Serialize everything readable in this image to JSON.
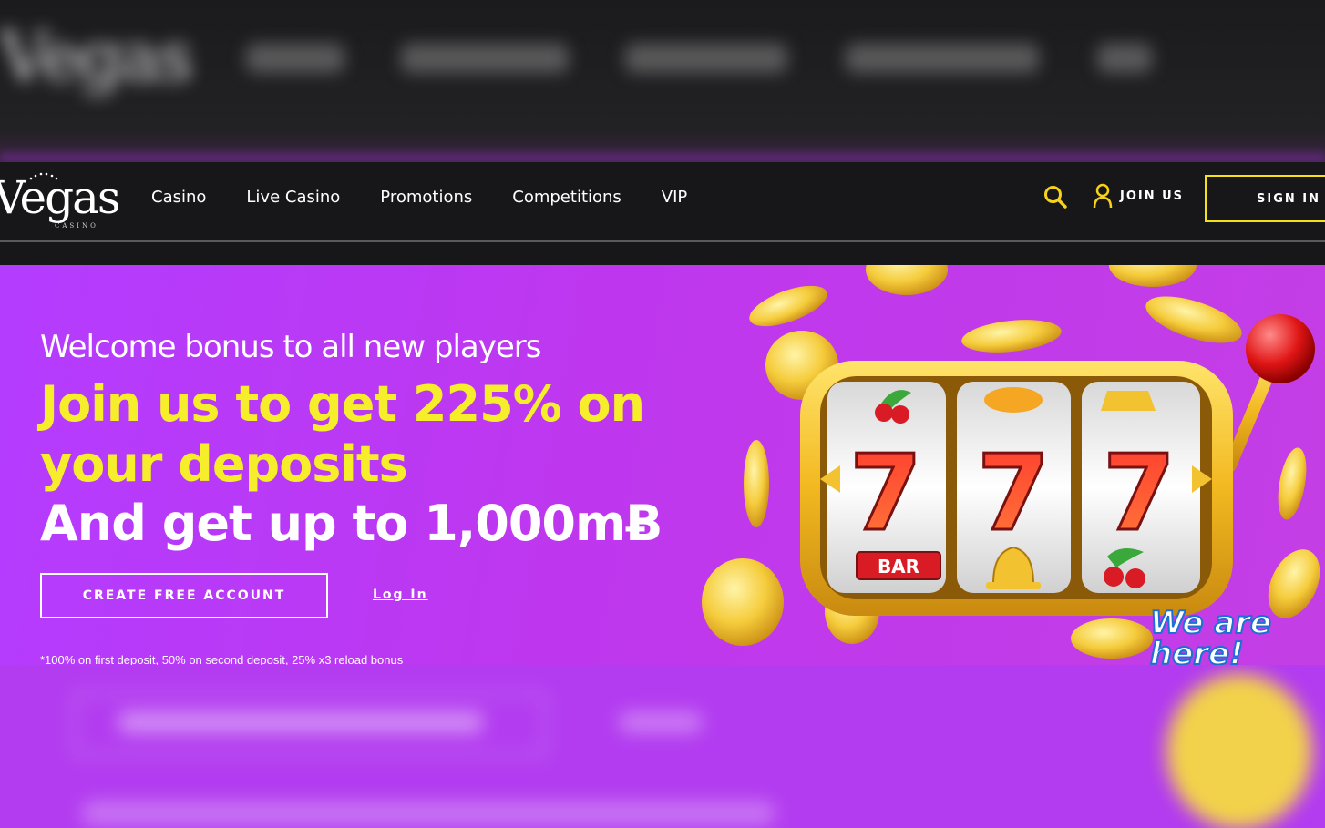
{
  "header": {
    "logo_text": "Vegas",
    "logo_subtext": "CASINO",
    "nav": [
      "Casino",
      "Live Casino",
      "Promotions",
      "Competitions",
      "VIP"
    ],
    "join_label": "JOIN US",
    "signin_label": "SIGN IN"
  },
  "hero": {
    "subtitle": "Welcome bonus to all new players",
    "headline_line1": "Join us to get 225% on",
    "headline_line2": "your deposits",
    "headline_line3": "And get up to 1,000mɃ",
    "cta_label": "CREATE FREE ACCOUNT",
    "login_label": "Log In",
    "fineprint": "*100% on first deposit, 50% on second deposit, 25% x3 reload bonus",
    "slot_symbols": [
      "7",
      "7",
      "7"
    ],
    "slot_bar_label": "BAR",
    "badge_text": "We are here!"
  },
  "colors": {
    "accent_yellow": "#f6ee2a",
    "hero_purple": "#b43cff",
    "header_bg": "#17171a"
  },
  "icons": {
    "search": "search-icon",
    "user": "user-icon"
  }
}
